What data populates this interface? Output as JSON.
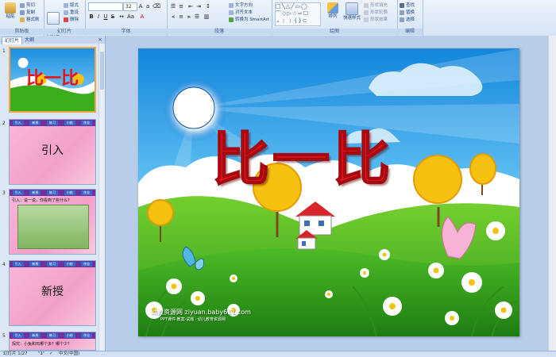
{
  "ribbon": {
    "groups": {
      "clipboard": "剪贴板",
      "slides": "幻灯片",
      "font": "字体",
      "paragraph": "段落",
      "drawing": "绘图",
      "editing": "编辑"
    },
    "paste": "粘贴",
    "cut": "剪切",
    "copy": "复制",
    "format_painter": "格式刷",
    "new_slide": "新建\n幻灯片",
    "layout": "版式",
    "reset": "重设",
    "delete": "删除",
    "font_size": "32",
    "text_direction": "文字方向",
    "align_text": "对齐文本",
    "smartart": "转换为 SmartArt",
    "arrange": "排列",
    "quick_styles": "快速样式",
    "shape_fill": "形状填充",
    "shape_outline": "形状轮廓",
    "shape_effects": "形状效果",
    "find": "查找",
    "replace": "替换",
    "select": "选择"
  },
  "panel": {
    "tab_slides": "幻灯片",
    "tab_outline": "大纲",
    "close": "×"
  },
  "thumbnails": [
    {
      "num": "1",
      "title": "比一比"
    },
    {
      "num": "2",
      "title": "引入"
    },
    {
      "num": "3",
      "title": "引入：说一说，你看到了些什么?"
    },
    {
      "num": "4",
      "title": "新授"
    },
    {
      "num": "5",
      "title": "探究：小兔和鸡哪个多？哪个少？"
    }
  ],
  "thumb_nav": [
    "引入",
    "新授",
    "练习",
    "小结",
    "作业"
  ],
  "slide": {
    "title": "比一比",
    "watermark": "幼教资源网 ziyuan.baby611.com",
    "watermark_sub": "PPT课件·教案·试题 · 幼儿教育资源网"
  },
  "status": {
    "slide_count": "幻灯片 1/27",
    "theme": "\"1\"",
    "language": "中文(中国)"
  },
  "colors": {
    "title_red": "#e8121b",
    "sky_top": "#1a8fe0",
    "grass": "#3cae1e",
    "accent_orange": "#f2a64b"
  }
}
